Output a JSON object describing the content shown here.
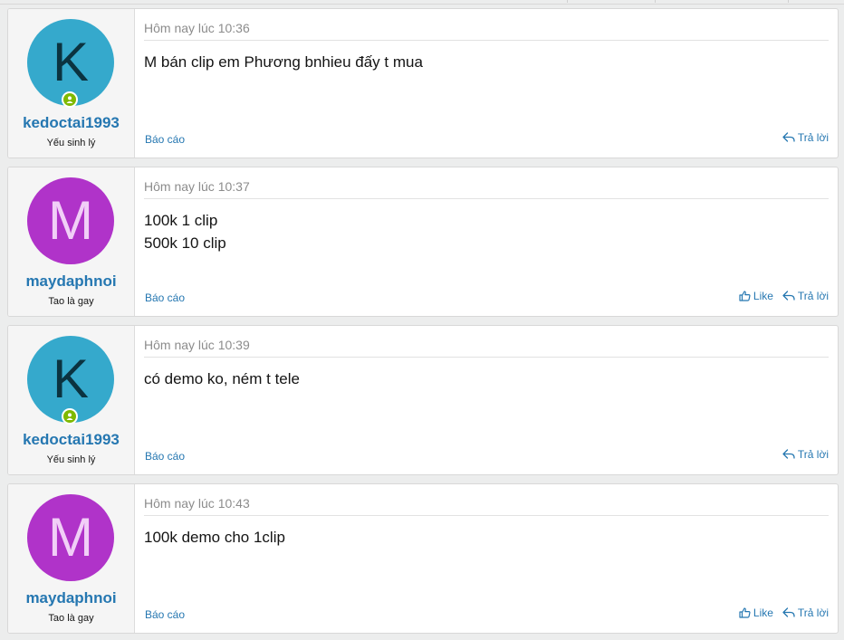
{
  "colors": {
    "link": "#2577b1",
    "avatar_k_bg": "#35a9cc",
    "avatar_k_fg": "#0b3340",
    "avatar_m_bg": "#b033c9",
    "avatar_m_fg": "#f1cff7",
    "online": "#7fb900"
  },
  "actions": {
    "report_label": "Báo cáo",
    "like_label": "Like",
    "reply_label": "Trả lời"
  },
  "posts": [
    {
      "avatar_letter": "K",
      "username": "kedoctai1993",
      "user_title": "Yếu sinh lý",
      "timestamp": "Hôm nay lúc 10:36",
      "lines": [
        "M bán clip em Phương bnhieu đấy t mua"
      ]
    },
    {
      "avatar_letter": "M",
      "username": "maydaphnoi",
      "user_title": "Tao là gay",
      "timestamp": "Hôm nay lúc 10:37",
      "lines": [
        "100k 1 clip",
        "500k 10 clip"
      ]
    },
    {
      "avatar_letter": "K",
      "username": "kedoctai1993",
      "user_title": "Yếu sinh lý",
      "timestamp": "Hôm nay lúc 10:39",
      "lines": [
        "có demo ko, ném t tele"
      ]
    },
    {
      "avatar_letter": "M",
      "username": "maydaphnoi",
      "user_title": "Tao là gay",
      "timestamp": "Hôm nay lúc 10:43",
      "lines": [
        "100k demo cho 1clip"
      ]
    }
  ]
}
